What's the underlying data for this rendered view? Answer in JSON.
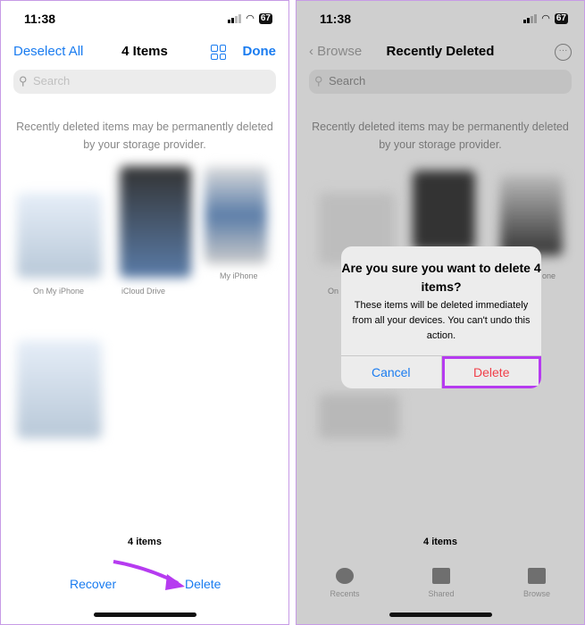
{
  "left": {
    "time": "11:38",
    "battery": "67",
    "nav": {
      "left": "Deselect All",
      "title": "4 Items",
      "right": "Done"
    },
    "search_placeholder": "Search",
    "note": [
      "Recently deleted items may be permanently deleted",
      "by your storage provider."
    ],
    "captions": [
      "On My iPhone",
      "iCloud Drive",
      "My iPhone"
    ],
    "count": "4 items",
    "recover": "Recover",
    "delete": "Delete"
  },
  "right": {
    "time": "11:38",
    "battery": "67",
    "nav": {
      "back": "Browse",
      "title": "Recently Deleted"
    },
    "search_placeholder": "Search",
    "note": [
      "Recently deleted items may be permanently deleted",
      "by your storage provider."
    ],
    "captions": [
      "On",
      "one"
    ],
    "count": "4 items",
    "dialog": {
      "title": "Are you sure you want to delete 4 items?",
      "message": "These items will be deleted immediately from all your devices. You can't undo this action.",
      "cancel": "Cancel",
      "delete": "Delete"
    },
    "tabs": [
      "Recents",
      "Shared",
      "Browse"
    ]
  },
  "colors": {
    "accent": "#1a7cf0",
    "destructive": "#f0404a",
    "highlight": "#b63bf0"
  }
}
